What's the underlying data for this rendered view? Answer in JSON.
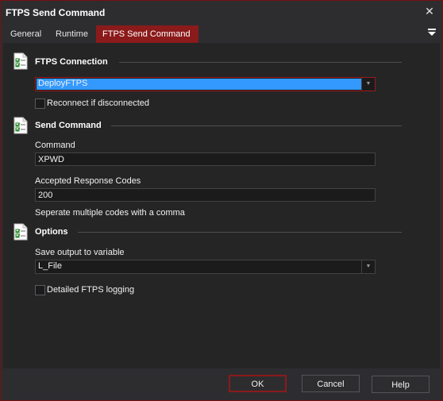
{
  "window": {
    "title": "FTPS Send Command",
    "close_label": "✕"
  },
  "tabs": [
    {
      "label": "General"
    },
    {
      "label": "Runtime"
    },
    {
      "label": "FTPS Send Command"
    }
  ],
  "sections": {
    "connection": {
      "title": "FTPS Connection",
      "selected_connection": "DeployFTPS",
      "reconnect_label": "Reconnect if disconnected",
      "reconnect_checked": false
    },
    "send_command": {
      "title": "Send Command",
      "command_label": "Command",
      "command_value": "XPWD",
      "codes_label": "Accepted Response Codes",
      "codes_value": "200",
      "codes_hint": "Seperate multiple codes with a comma"
    },
    "options": {
      "title": "Options",
      "save_output_label": "Save output to variable",
      "save_output_value": "L_File",
      "detailed_logging_label": "Detailed FTPS logging",
      "detailed_logging_checked": false
    }
  },
  "footer": {
    "ok_label": "OK",
    "cancel_label": "Cancel",
    "help_label": "Help"
  },
  "icons": {
    "section_icon": "checklist-document-icon",
    "dropdown_arrow": "▼"
  },
  "colors": {
    "accent": "#8b1a1a",
    "selection": "#3399ff",
    "background": "#252526"
  }
}
